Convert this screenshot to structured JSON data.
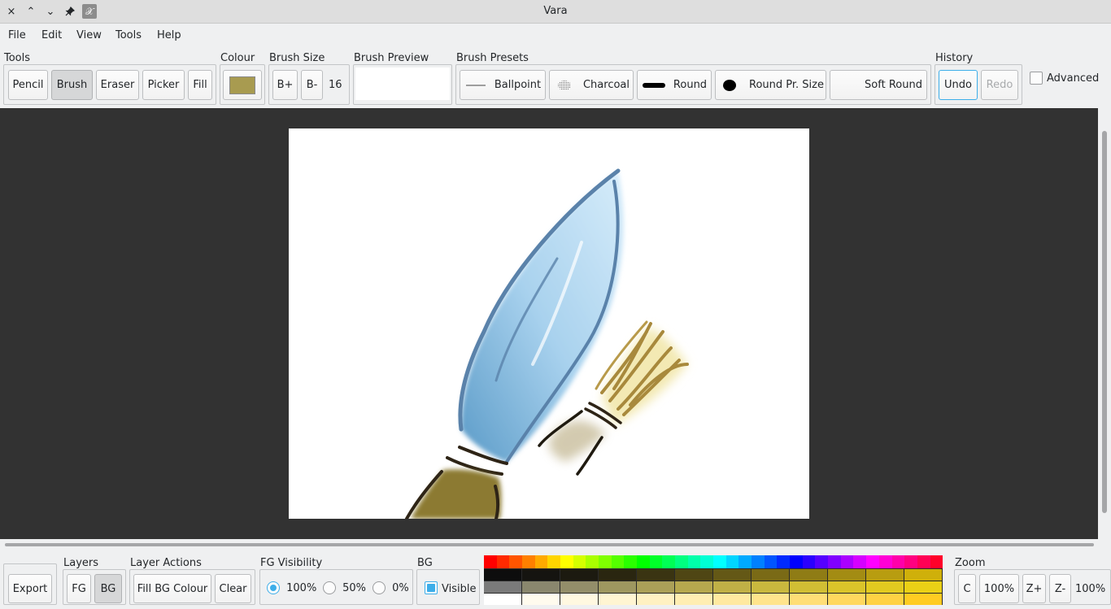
{
  "window": {
    "title": "Vara"
  },
  "titlebar_icons": {
    "close": "×",
    "minimize": "⌃",
    "maximize": "⌄",
    "pin": "📌",
    "app": "𝒳"
  },
  "menu": [
    "File",
    "Edit",
    "View",
    "Tools",
    "Help"
  ],
  "tools": {
    "label": "Tools",
    "items": [
      "Pencil",
      "Brush",
      "Eraser",
      "Picker",
      "Fill"
    ],
    "active": "Brush"
  },
  "colour": {
    "label": "Colour",
    "value": "#a89b50"
  },
  "brush_size": {
    "label": "Brush Size",
    "inc": "B+",
    "dec": "B-",
    "value": "16"
  },
  "brush_preview": {
    "label": "Brush Preview"
  },
  "brush_presets": {
    "label": "Brush Presets",
    "items": [
      "Ballpoint",
      "Charcoal",
      "Round",
      "Round Pr. Size",
      "Soft Round"
    ]
  },
  "history": {
    "label": "History",
    "undo": "Undo",
    "redo": "Redo"
  },
  "advanced": {
    "label": "Advanced",
    "checked": false
  },
  "bottom": {
    "export": "Export",
    "layers": {
      "label": "Layers",
      "fg": "FG",
      "bg": "BG",
      "active": "BG"
    },
    "layer_actions": {
      "label": "Layer Actions",
      "fill": "Fill BG Colour",
      "clear": "Clear"
    },
    "fg_visibility": {
      "label": "FG Visibility",
      "options": [
        "100%",
        "50%",
        "0%"
      ],
      "selected": "100%"
    },
    "bg": {
      "label": "BG",
      "visible_label": "Visible",
      "visible": true
    },
    "zoom": {
      "label": "Zoom",
      "center": "C",
      "reset": "100%",
      "zoom_in": "Z+",
      "zoom_out": "Z-",
      "level": "100%"
    }
  },
  "palette": {
    "hue_row": [
      "#ff0000",
      "#ff2a00",
      "#ff5500",
      "#ff8000",
      "#ffaa00",
      "#ffd500",
      "#ffff00",
      "#d5ff00",
      "#aaff00",
      "#80ff00",
      "#55ff00",
      "#2aff00",
      "#00ff00",
      "#00ff2a",
      "#00ff55",
      "#00ff80",
      "#00ffaa",
      "#00ffd5",
      "#00ffff",
      "#00d5ff",
      "#00aaff",
      "#0080ff",
      "#0055ff",
      "#002aff",
      "#0000ff",
      "#2a00ff",
      "#5500ff",
      "#8000ff",
      "#aa00ff",
      "#d500ff",
      "#ff00ff",
      "#ff00d5",
      "#ff00aa",
      "#ff0080",
      "#ff0055",
      "#ff002a"
    ],
    "shade_rows": [
      [
        "#0d0d0d",
        "#151410",
        "#1c1a10",
        "#2a2610",
        "#3a3412",
        "#4f4614",
        "#645816",
        "#7a6a16",
        "#8f7c15",
        "#a38c13",
        "#b89d10",
        "#cfb00a"
      ],
      [
        "#7a7a7a",
        "#8a876e",
        "#938e6a",
        "#9e9760",
        "#aba058",
        "#b6a84e",
        "#c0b046",
        "#c9b83e",
        "#d1be34",
        "#dac42a",
        "#e2ca20",
        "#ead016"
      ],
      [
        "#ffffff",
        "#fffbee",
        "#fff8e0",
        "#fff5d2",
        "#fff1c2",
        "#ffeeb2",
        "#ffe9a0",
        "#ffe48c",
        "#ffde76",
        "#ffd85e",
        "#ffd244",
        "#ffcc22"
      ]
    ]
  }
}
